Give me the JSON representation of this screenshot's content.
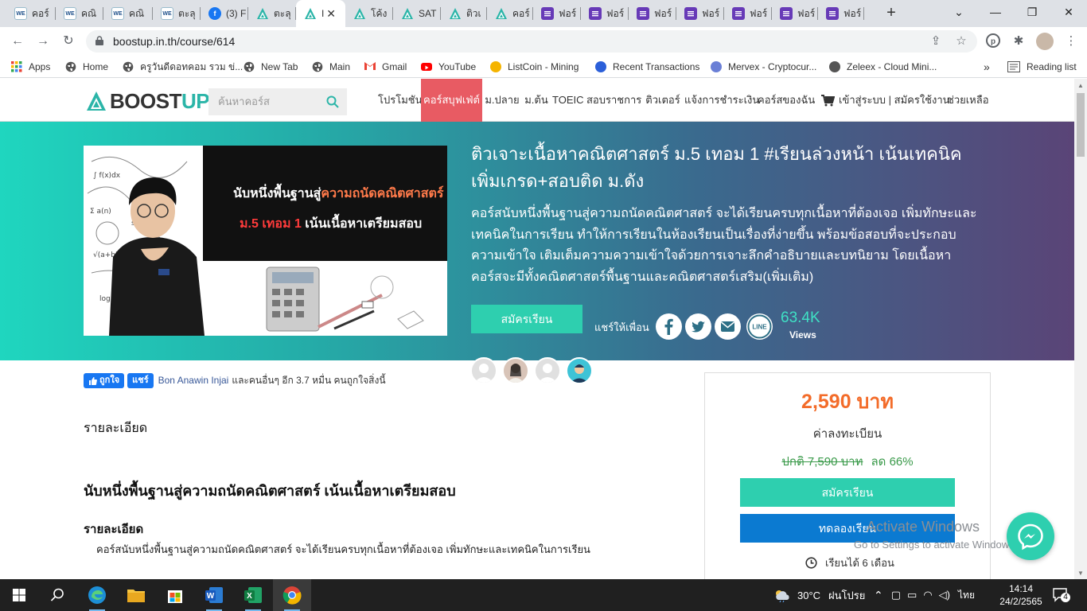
{
  "browser": {
    "tabs": [
      {
        "label": "คอร์",
        "icon": "we-icon"
      },
      {
        "label": "คณิ",
        "icon": "we-icon"
      },
      {
        "label": "คณิ",
        "icon": "we-icon"
      },
      {
        "label": "ตะลุ",
        "icon": "we-icon"
      },
      {
        "label": "(3) F",
        "icon": "facebook-icon"
      },
      {
        "label": "ตะลุ",
        "icon": "boostup-icon"
      },
      {
        "label": "I",
        "icon": "boostup-icon",
        "active": true
      },
      {
        "label": "โค้ง",
        "icon": "boostup-icon"
      },
      {
        "label": "SAT",
        "icon": "boostup-icon"
      },
      {
        "label": "ติวเ",
        "icon": "boostup-icon"
      },
      {
        "label": "คอร์",
        "icon": "boostup-icon"
      },
      {
        "label": "ฟอร์",
        "icon": "forms-icon"
      },
      {
        "label": "ฟอร์",
        "icon": "forms-icon"
      },
      {
        "label": "ฟอร์",
        "icon": "forms-icon"
      },
      {
        "label": "ฟอร์",
        "icon": "forms-icon"
      },
      {
        "label": "ฟอร์",
        "icon": "forms-icon"
      },
      {
        "label": "ฟอร์",
        "icon": "forms-icon"
      },
      {
        "label": "ฟอร์",
        "icon": "forms-icon"
      }
    ],
    "url": "boostup.in.th/course/614",
    "bookmarks": [
      {
        "label": "Apps",
        "icon": "apps-grid-icon",
        "color": "#e04b3a"
      },
      {
        "label": "Home",
        "icon": "globe-icon",
        "color": "#444"
      },
      {
        "label": "ครูวันดีดอทคอม รวม ข่...",
        "icon": "globe-icon",
        "color": "#444"
      },
      {
        "label": "New Tab",
        "icon": "globe-icon",
        "color": "#444"
      },
      {
        "label": "Main",
        "icon": "globe-icon",
        "color": "#444"
      },
      {
        "label": "Gmail",
        "icon": "gmail-icon",
        "color": "#ea4335"
      },
      {
        "label": "YouTube",
        "icon": "youtube-icon",
        "color": "#ff0000"
      },
      {
        "label": "ListCoin - Mining",
        "icon": "listcoin-icon",
        "color": "#f5b400"
      },
      {
        "label": "Recent Transactions",
        "icon": "coin-icon",
        "color": "#2b5fd9"
      },
      {
        "label": "Mervex - Cryptocur...",
        "icon": "mervex-icon",
        "color": "#6a7fd6"
      },
      {
        "label": "Zeleex - Cloud Mini...",
        "icon": "zeleex-icon",
        "color": "#555"
      }
    ],
    "bookmarks_more": "»",
    "reading_list": "Reading list"
  },
  "site": {
    "logo_a": "BOOST",
    "logo_b": "UP",
    "search_placeholder": "ค้นหาคอร์ส",
    "nav": [
      {
        "label": "โปรโมชัน"
      },
      {
        "label": "คอร์สบุฟเฟ่ต์",
        "highlight": true
      },
      {
        "label": "ม.ปลาย"
      },
      {
        "label": "ม.ต้น"
      },
      {
        "label": "TOEIC"
      },
      {
        "label": "สอบราชการ"
      },
      {
        "label": "ติวเตอร์"
      },
      {
        "label": "แจ้งการชำระเงิน"
      },
      {
        "label": "คอร์สของฉัน"
      },
      {
        "label": "เข้าสู่ระบบ | สมัครใช้งาน"
      },
      {
        "label": "ช่วยเหลือ"
      }
    ],
    "colors": {
      "accent": "#2ecfaf",
      "highlight": "#e85b63",
      "price": "#f36c2a",
      "trial": "#0b7ad1"
    }
  },
  "hero": {
    "banner_line1_a": "นับหนึ่งพื้นฐานสู่",
    "banner_line1_b": "ความถนัดคณิตศาสตร์",
    "banner_line2_a": "ม.5 เทอม 1",
    "banner_line2_b": " เน้นเนื้อหาเตรียมสอบ",
    "title": "ติวเจาะเนื้อหาคณิตศาสตร์ ม.5 เทอม 1 #เรียนล่วงหน้า เน้นเทคนิคเพิ่มเกรด+สอบติด ม.ดัง",
    "description": "คอร์สนับหนึ่งพื้นฐานสู่ความถนัดคณิตศาสตร์ จะได้เรียนครบทุกเนื้อหาที่ต้องเจอ เพิ่มทักษะและเทคนิคในการเรียน ทำให้การเรียนในห้องเรียนเป็นเรื่องที่ง่ายขึ้น พร้อมข้อสอบที่จะประกอบความเข้าใจ เติมเต็มความความเข้าใจด้วยการเจาะลึกคำอธิบายและบทนิยาม โดยเนื้อหาคอร์สจะมีทั้งคณิตศาสตร์พื้นฐานและคณิตศาสตร์เสริม(เพิ่มเติม)",
    "enroll_button": "สมัครเรียน",
    "share_label": "แชร์ให้เพื่อน",
    "share_icons": [
      "facebook-icon",
      "twitter-icon",
      "email-icon",
      "line-icon"
    ],
    "line_text": "LINE",
    "views": "63.4K",
    "views_label": "Views"
  },
  "content": {
    "fb_like": "ถูกใจ",
    "fb_share": "แชร์",
    "fb_name": "Bon Anawin Injai",
    "fb_rest": "และคนอื่นๆ อีก 3.7 หมื่น คนถูกใจสิ่งนี้",
    "detail_heading": "รายละเอียด",
    "sub_heading": "นับหนึ่งพื้นฐานสู่ความถนัดคณิตศาสตร์ เน้นเนื้อหาเตรียมสอบ",
    "detail_heading_2": "รายละเอียด",
    "detail_text": "คอร์สนับหนึ่งพื้นฐานสู่ความถนัดคณิตศาสตร์ จะได้เรียนครบทุกเนื้อหาที่ต้องเจอ เพิ่มทักษะและเทคนิคในการเรียน"
  },
  "pricebox": {
    "price": "2,590 บาท",
    "fee_label": "ค่าลงทะเบียน",
    "old_price": "ปกติ 7,590 บาท",
    "discount": "ลด 66%",
    "enroll": "สมัครเรียน",
    "trial": "ทดลองเรียน",
    "duration": "เรียนได้ 6 เดือน"
  },
  "windows_watermark": {
    "line1": "Activate Windows",
    "line2": "Go to Settings to activate Windows."
  },
  "taskbar": {
    "apps": [
      "start-icon",
      "search-icon",
      "edge-icon",
      "file-explorer-icon",
      "store-icon",
      "word-icon",
      "excel-icon",
      "chrome-icon"
    ],
    "weather_temp": "30°C",
    "weather_desc": "ฝนโปรย",
    "lang": "ไทย",
    "time": "14:14",
    "date": "24/2/2565",
    "notifications": "4"
  }
}
